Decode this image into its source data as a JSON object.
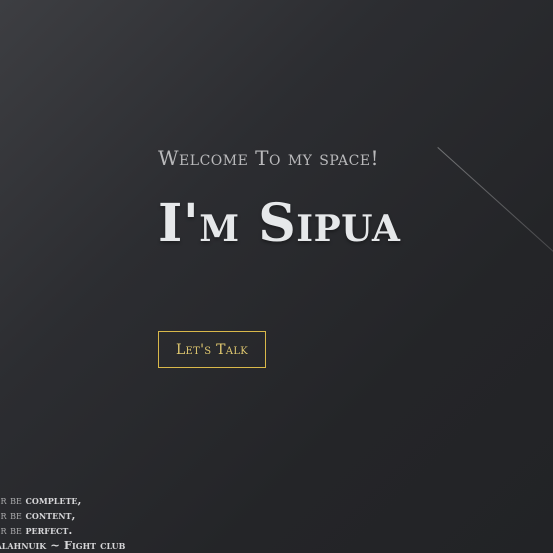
{
  "hero": {
    "welcome": "Welcome To my space!",
    "headline": "I'm Sipua",
    "cta_label": "Let's Talk"
  },
  "quote": {
    "lines": [
      {
        "prefix": "never be ",
        "emphasis": "complete,"
      },
      {
        "prefix": "never be ",
        "emphasis": "content,"
      },
      {
        "prefix": "never be ",
        "emphasis": "perfect."
      }
    ],
    "attribution": "k Palahnuik ~ Fight club"
  },
  "colors": {
    "accent": "#d9b84a",
    "background": "#2a2b2f",
    "headline": "#e6e8ea"
  }
}
